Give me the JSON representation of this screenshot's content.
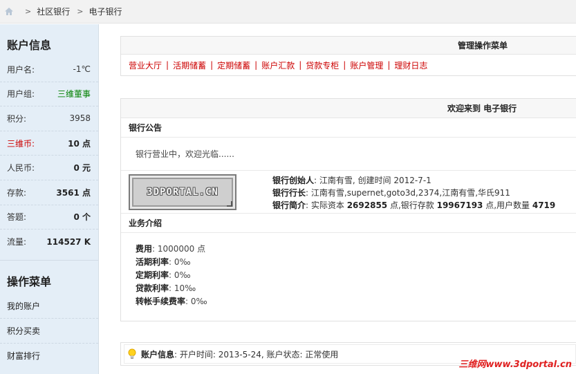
{
  "breadcrumb": {
    "icon": "home-icon",
    "items": [
      "社区银行",
      "电子银行"
    ],
    "separator": ">"
  },
  "sidebar": {
    "account_title": "账户信息",
    "info": [
      {
        "label": "用户名:",
        "value": "-1℃"
      },
      {
        "label": "用户组:",
        "value": "三维董事"
      },
      {
        "label": "积分:",
        "value": "3958"
      },
      {
        "label": "三维币:",
        "value": "10 点"
      },
      {
        "label": "人民币:",
        "value": "0 元"
      },
      {
        "label": "存款:",
        "value": "3561 点"
      },
      {
        "label": "答题:",
        "value": "0 个"
      },
      {
        "label": "流量:",
        "value": "114527 K"
      }
    ],
    "menu_title": "操作菜单",
    "menu": [
      "我的账户",
      "积分买卖",
      "财富排行"
    ]
  },
  "menu_panel": {
    "title": "管理操作菜单",
    "links": [
      "营业大厅",
      "活期储蓄",
      "定期储蓄",
      "账户汇款",
      "贷款专柜",
      "账户管理",
      "理财日志"
    ],
    "separator": "|"
  },
  "bank_panel": {
    "title": "欢迎来到 电子银行",
    "notice_title": "银行公告",
    "notice_text": "银行营业中，欢迎光临......",
    "logo_text": "3DPORTAL.CN",
    "founder_label": "银行创始人",
    "founder_value": ": 江南有雪, 创建时间  2012-7-1",
    "president_label": "银行行长",
    "president_value": ": 江南有雪,supernet,goto3d,2374,江南有雪,华氏911",
    "intro_label": "银行简介",
    "intro_prefix": ": 实际资本 ",
    "capital": "2692855",
    "intro_mid1": " 点,银行存款 ",
    "deposits": "19967193",
    "intro_mid2": " 点,用户数量 ",
    "users": "4719",
    "biz_title": "业务介绍",
    "biz": [
      {
        "label": "费用",
        "value": ": 1000000 点"
      },
      {
        "label": "活期利率",
        "value": ": 0‰"
      },
      {
        "label": "定期利率",
        "value": ": 0‰"
      },
      {
        "label": "贷款利率",
        "value": ": 10‰"
      },
      {
        "label": "转帐手续费率",
        "value": ": 0‰"
      }
    ]
  },
  "status_bar": {
    "icon": "bulb-icon",
    "label": "账户信息",
    "text": ": 开户时间: 2013-5-24, 账户状态: 正常使用"
  },
  "watermark": "三维网www.3dportal.cn",
  "colors": {
    "sidebar_bg": "#e4eef7",
    "link_red": "#cc0000",
    "group_green": "#008000"
  }
}
